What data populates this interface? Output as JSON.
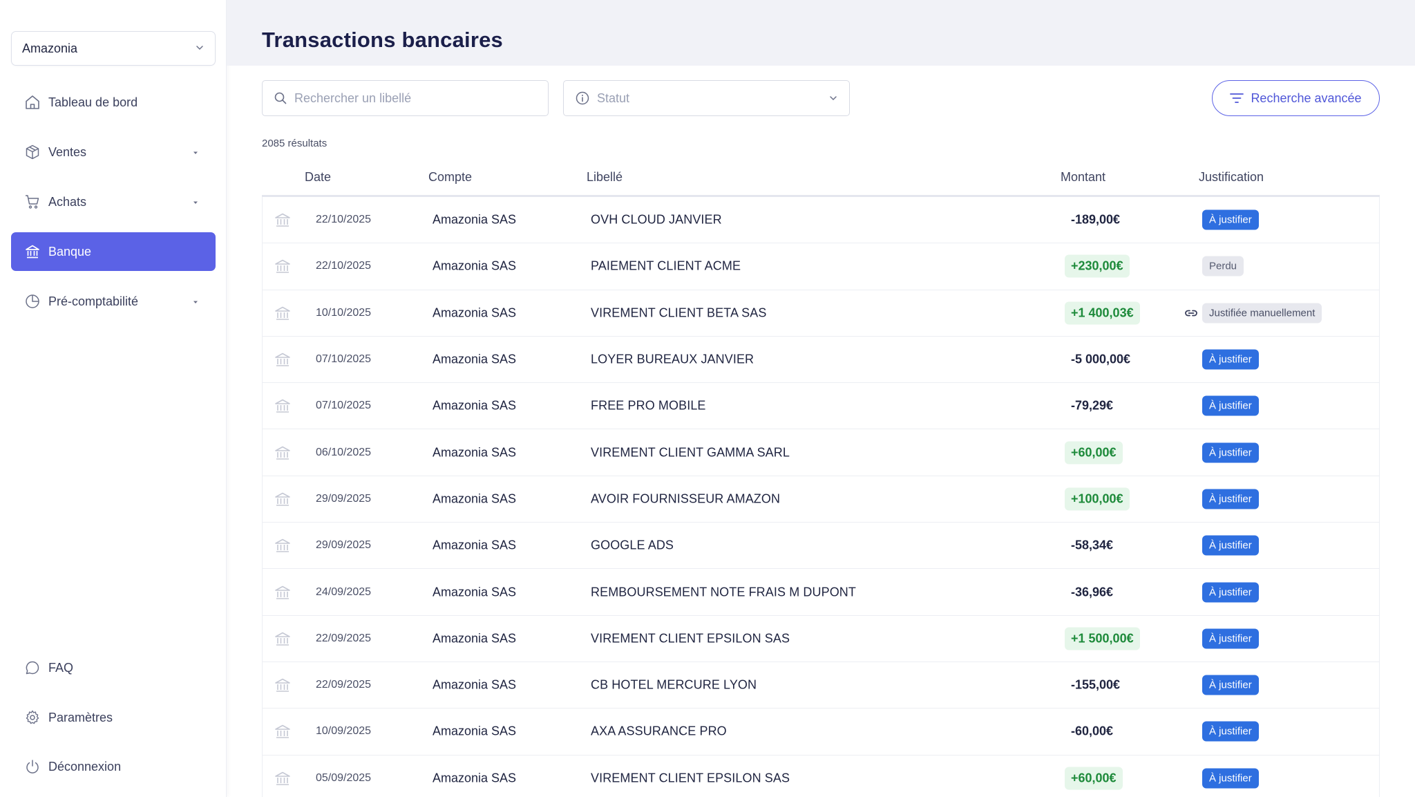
{
  "sidebar": {
    "company": "Amazonia",
    "items": [
      {
        "label": "Tableau de bord",
        "icon": "home-icon"
      },
      {
        "label": "Ventes",
        "icon": "package-icon"
      },
      {
        "label": "Achats",
        "icon": "cart-icon"
      },
      {
        "label": "Banque",
        "icon": "bank-icon"
      },
      {
        "label": "Pré-comptabilité",
        "icon": "pie-chart-icon"
      }
    ],
    "bottom_items": [
      {
        "label": "FAQ",
        "icon": "chat-bubble-icon"
      },
      {
        "label": "Paramètres",
        "icon": "gear-icon"
      },
      {
        "label": "Déconnexion",
        "icon": "power-icon"
      }
    ],
    "active_item": "Banque"
  },
  "page": {
    "title": "Transactions bancaires"
  },
  "filters": {
    "search_placeholder": "Rechercher un libellé",
    "status_placeholder": "Statut",
    "advanced_label": "Recherche avancée"
  },
  "results_count": "2085 résultats",
  "table": {
    "headers": {
      "date": "Date",
      "account": "Compte",
      "label": "Libellé",
      "amount": "Montant",
      "justification": "Justification"
    },
    "rows": [
      {
        "date": "22/10/2025",
        "account": "Amazonia SAS",
        "label": "OVH CLOUD JANVIER",
        "amount": "-189,00€",
        "positive": false,
        "justification": "À justifier",
        "status": "todo"
      },
      {
        "date": "22/10/2025",
        "account": "Amazonia SAS",
        "label": "PAIEMENT CLIENT ACME",
        "amount": "+230,00€",
        "positive": true,
        "justification": "Perdu",
        "status": "lost"
      },
      {
        "date": "10/10/2025",
        "account": "Amazonia SAS",
        "label": "VIREMENT CLIENT BETA SAS",
        "amount": "+1 400,03€",
        "positive": true,
        "justification": "Justifiée manuellement",
        "status": "manual"
      },
      {
        "date": "07/10/2025",
        "account": "Amazonia SAS",
        "label": "LOYER BUREAUX JANVIER",
        "amount": "-5 000,00€",
        "positive": false,
        "justification": "À justifier",
        "status": "todo"
      },
      {
        "date": "07/10/2025",
        "account": "Amazonia SAS",
        "label": "FREE PRO MOBILE",
        "amount": "-79,29€",
        "positive": false,
        "justification": "À justifier",
        "status": "todo"
      },
      {
        "date": "06/10/2025",
        "account": "Amazonia SAS",
        "label": "VIREMENT CLIENT GAMMA SARL",
        "amount": "+60,00€",
        "positive": true,
        "justification": "À justifier",
        "status": "todo"
      },
      {
        "date": "29/09/2025",
        "account": "Amazonia SAS",
        "label": "AVOIR FOURNISSEUR AMAZON",
        "amount": "+100,00€",
        "positive": true,
        "justification": "À justifier",
        "status": "todo"
      },
      {
        "date": "29/09/2025",
        "account": "Amazonia SAS",
        "label": "GOOGLE ADS",
        "amount": "-58,34€",
        "positive": false,
        "justification": "À justifier",
        "status": "todo"
      },
      {
        "date": "24/09/2025",
        "account": "Amazonia SAS",
        "label": "REMBOURSEMENT NOTE FRAIS M DUPONT",
        "amount": "-36,96€",
        "positive": false,
        "justification": "À justifier",
        "status": "todo"
      },
      {
        "date": "22/09/2025",
        "account": "Amazonia SAS",
        "label": "VIREMENT CLIENT EPSILON SAS",
        "amount": "+1 500,00€",
        "positive": true,
        "justification": "À justifier",
        "status": "todo"
      },
      {
        "date": "22/09/2025",
        "account": "Amazonia SAS",
        "label": "CB HOTEL MERCURE LYON",
        "amount": "-155,00€",
        "positive": false,
        "justification": "À justifier",
        "status": "todo"
      },
      {
        "date": "10/09/2025",
        "account": "Amazonia SAS",
        "label": "AXA ASSURANCE PRO",
        "amount": "-60,00€",
        "positive": false,
        "justification": "À justifier",
        "status": "todo"
      },
      {
        "date": "05/09/2025",
        "account": "Amazonia SAS",
        "label": "VIREMENT CLIENT EPSILON SAS",
        "amount": "+60,00€",
        "positive": true,
        "justification": "À justifier",
        "status": "todo"
      }
    ]
  },
  "colors": {
    "accent": "#5b62e6",
    "badge_todo": "#2e6fe0",
    "positive_text": "#1d8a3a",
    "positive_bg": "#e6f6ea"
  }
}
